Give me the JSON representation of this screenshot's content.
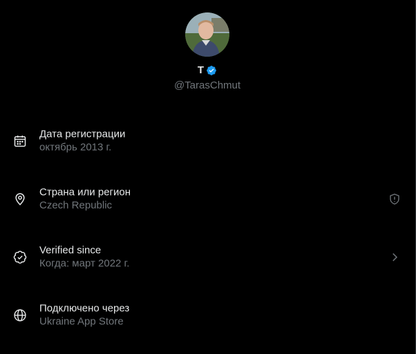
{
  "profile": {
    "display_name": "T",
    "handle": "@TarasChmut",
    "verified_color": "#1d9bf0"
  },
  "rows": [
    {
      "title": "Дата регистрации",
      "subtitle": "октябрь 2013 г.",
      "icon": "calendar-icon"
    },
    {
      "title": "Страна или регион",
      "subtitle": "Czech Republic",
      "icon": "location-pin-icon",
      "end_icon": "shield-alert-icon"
    },
    {
      "title": "Verified since",
      "subtitle": "Когда: март 2022 г.",
      "icon": "verified-badge-icon",
      "end_icon": "chevron-right-icon"
    },
    {
      "title": "Подключено через",
      "subtitle": "Ukraine App Store",
      "icon": "globe-icon"
    }
  ],
  "colors": {
    "background": "#000000",
    "primary_text": "#e7e9ea",
    "secondary_text": "#71767b",
    "accent": "#1d9bf0"
  }
}
